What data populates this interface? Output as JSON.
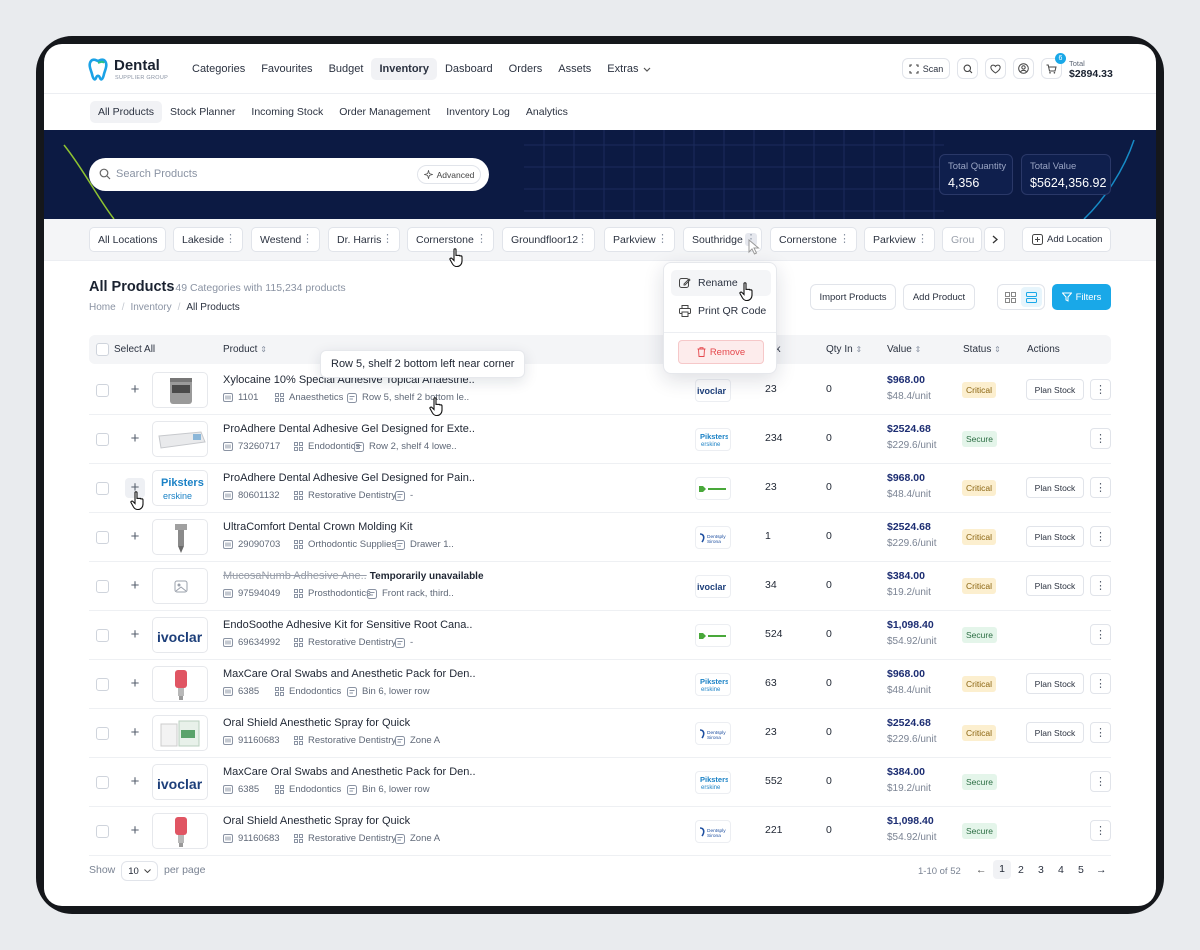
{
  "brand": {
    "name": "Dental",
    "tagline": "SUPPLIER GROUP"
  },
  "nav": {
    "items": [
      "Categories",
      "Favourites",
      "Budget",
      "Inventory",
      "Dasboard",
      "Orders",
      "Assets",
      "Extras"
    ],
    "active": "Inventory"
  },
  "toolbar": {
    "scan_label": "Scan",
    "cart_count": "6",
    "total_label": "Total",
    "total_value": "$2894.33"
  },
  "subnav": {
    "items": [
      "All Products",
      "Stock Planner",
      "Incoming Stock",
      "Order Management",
      "Inventory Log",
      "Analytics"
    ],
    "active": "All Products"
  },
  "search": {
    "placeholder": "Search Products",
    "advanced_label": "Advanced"
  },
  "stats": {
    "qty_label": "Total Quantity",
    "qty_value": "4,356",
    "value_label": "Total Value",
    "value_value": "$5624,356.92"
  },
  "locations": {
    "all_label": "All Locations",
    "items": [
      "Lakeside",
      "Westend",
      "Dr. Harris",
      "Cornerstone",
      "Groundfloor12",
      "Parkview",
      "Southridge",
      "Cornerstone",
      "Parkview",
      "Grou"
    ],
    "add_label": "Add Location"
  },
  "page": {
    "title": "All Products",
    "subtitle": "- 49 Categories with 115,234 products",
    "breadcrumb": [
      "Home",
      "Inventory",
      "All Products"
    ],
    "import_label": "Import Products",
    "add_label": "Add Product",
    "filters_label": "Filters"
  },
  "table": {
    "headers": {
      "select_all": "Select All",
      "product": "Product",
      "stock": "ock",
      "qty_in": "Qty In",
      "value": "Value",
      "status": "Status",
      "actions": "Actions"
    },
    "plan_label": "Plan Stock",
    "rows": [
      {
        "name": "Xylocaine 10% Special Adhesive Topical Anaesthe..",
        "sku": "1101",
        "category": "Anaesthetics",
        "location": "Row 5, shelf 2 bottom le..",
        "supplier": "ivoclar",
        "stock": "23",
        "qty_in": "0",
        "value": "$968.00",
        "unit": "$48.4/unit",
        "status": "Critical",
        "plan": true
      },
      {
        "name": "ProAdhere Dental Adhesive Gel Designed for Exte..",
        "sku": "73260717",
        "category": "Endodontics",
        "location": "Row 2, shelf 4 lowe..",
        "supplier": "piksters",
        "stock": "234",
        "qty_in": "0",
        "value": "$2524.68",
        "unit": "$229.6/unit",
        "status": "Secure",
        "plan": false
      },
      {
        "name": "ProAdhere Dental Adhesive Gel Designed for Pain..",
        "sku": "80601132",
        "category": "Restorative Dentistry",
        "location": "-",
        "supplier": "dentsply-green",
        "stock": "23",
        "qty_in": "0",
        "value": "$968.00",
        "unit": "$48.4/unit",
        "status": "Critical",
        "plan": true
      },
      {
        "name": "UltraComfort Dental Crown Molding Kit",
        "sku": "29090703",
        "category": "Orthodontic Supplies",
        "location": "Drawer 1..",
        "supplier": "dentsply",
        "stock": "1",
        "qty_in": "0",
        "value": "$2524.68",
        "unit": "$229.6/unit",
        "status": "Critical",
        "plan": true
      },
      {
        "name": "MucosaNumb Adhesive Ane..",
        "unavailable": "Temporarily unavailable",
        "sku": "97594049",
        "category": "Prosthodontics",
        "location": "Front rack, third..",
        "supplier": "ivoclar",
        "stock": "34",
        "qty_in": "0",
        "value": "$384.00",
        "unit": "$19.2/unit",
        "status": "Critical",
        "plan": true
      },
      {
        "name": "EndoSoothe Adhesive Kit for Sensitive Root Cana..",
        "sku": "69634992",
        "category": "Restorative Dentistry",
        "location": "-",
        "supplier": "dentsply-green",
        "stock": "524",
        "qty_in": "0",
        "value": "$1,098.40",
        "unit": "$54.92/unit",
        "status": "Secure",
        "plan": false
      },
      {
        "name": "MaxCare Oral Swabs and Anesthetic Pack for Den..",
        "sku": "6385",
        "category": "Endodontics",
        "location": "Bin 6, lower row",
        "supplier": "piksters",
        "stock": "63",
        "qty_in": "0",
        "value": "$968.00",
        "unit": "$48.4/unit",
        "status": "Critical",
        "plan": true
      },
      {
        "name": "Oral Shield Anesthetic Spray for Quick",
        "sku": "91160683",
        "category": "Restorative Dentistry",
        "location": "Zone A",
        "supplier": "dentsply",
        "stock": "23",
        "qty_in": "0",
        "value": "$2524.68",
        "unit": "$229.6/unit",
        "status": "Critical",
        "plan": true
      },
      {
        "name": "MaxCare Oral Swabs and Anesthetic Pack for Den..",
        "sku": "6385",
        "category": "Endodontics",
        "location": "Bin 6, lower row",
        "supplier": "piksters",
        "stock": "552",
        "qty_in": "0",
        "value": "$384.00",
        "unit": "$19.2/unit",
        "status": "Secure",
        "plan": false
      },
      {
        "name": "Oral Shield Anesthetic Spray for Quick",
        "sku": "91160683",
        "category": "Restorative Dentistry",
        "location": "Zone A",
        "supplier": "dentsply",
        "stock": "221",
        "qty_in": "0",
        "value": "$1,098.40",
        "unit": "$54.92/unit",
        "status": "Secure",
        "plan": false
      }
    ]
  },
  "tooltip": {
    "text": "Row 5, shelf 2 bottom left near corner"
  },
  "context_menu": {
    "rename": "Rename",
    "print": "Print QR Code",
    "remove": "Remove"
  },
  "pagination": {
    "show_label": "Show",
    "per_page_value": "10",
    "per_page_label": "per page",
    "range": "1-10 of 52",
    "pages": [
      "1",
      "2",
      "3",
      "4",
      "5"
    ],
    "current": "1"
  },
  "colors": {
    "navy": "#0c1a43",
    "accent": "#19a8e8",
    "critical_bg": "#fcefcf",
    "secure_bg": "#e4f5ea",
    "remove": "#e5484d"
  }
}
